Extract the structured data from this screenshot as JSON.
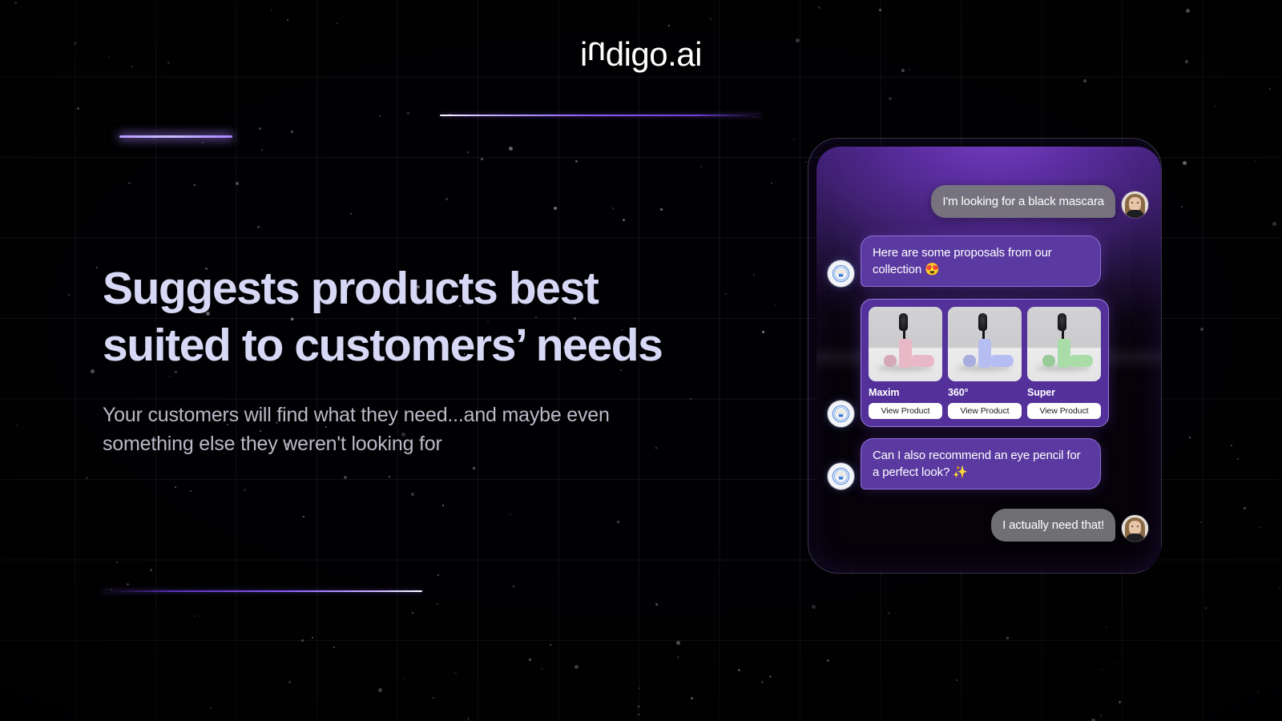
{
  "brand": {
    "logo_part1": "i",
    "logo_flipped_letter": "u",
    "logo_part2": "digo.ai",
    "logo_full": "indigo.ai"
  },
  "hero": {
    "heading_line1": "Suggests products best",
    "heading_line2": "suited to customers’ needs",
    "subheading_line1": "Your customers will find what they need...and maybe even",
    "subheading_line2": "something else they weren't looking for",
    "heading_color": "#d7d8f5",
    "subheading_color": "#b9bac6"
  },
  "chat": {
    "messages": [
      {
        "id": "m1",
        "sender": "user",
        "text": "I'm looking for a black mascara",
        "avatar": "user-photo-avatar"
      },
      {
        "id": "m2",
        "sender": "bot",
        "text": "Here are some proposals from our collection 😍",
        "avatar": "bot-logo-avatar"
      },
      {
        "id": "m3",
        "sender": "bot",
        "type": "product-carousel",
        "avatar": "bot-logo-avatar"
      },
      {
        "id": "m4",
        "sender": "bot",
        "text": "Can I also recommend an eye pencil for a perfect look? ✨",
        "avatar": "bot-logo-avatar"
      },
      {
        "id": "m5",
        "sender": "user",
        "text": "I actually need that!",
        "avatar": "user-photo-avatar"
      }
    ],
    "products": [
      {
        "name": "Maxim",
        "button_label": "View Product",
        "color": "#e9b8c6",
        "color_name": "pink"
      },
      {
        "name": "360°",
        "button_label": "View Product",
        "color": "#b6bdf2",
        "color_name": "periwinkle"
      },
      {
        "name": "Super",
        "button_label": "View Product",
        "color": "#a9dca6",
        "color_name": "green"
      }
    ],
    "bubble_colors": {
      "user": "#7a7a7e",
      "bot": "#5a39a0",
      "bot_border": "#8f6fd6",
      "carousel": "#53309a"
    }
  },
  "theme": {
    "background": "#010103",
    "accent_purple": "#8b5cf6",
    "accent_white": "#ffffff",
    "panel_glow": "#b69bff"
  }
}
